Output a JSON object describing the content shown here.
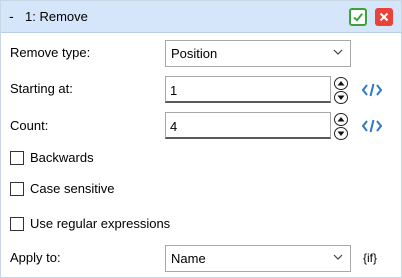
{
  "titlebar": {
    "collapse_glyph": "-",
    "title": "1: Remove",
    "accept_icon": "check-icon",
    "close_icon": "close-icon",
    "accept_color": "#3ca33a",
    "close_color": "#e8423b"
  },
  "remove_type": {
    "label": "Remove type:",
    "value": "Position"
  },
  "starting_at": {
    "label": "Starting at:",
    "value": "1"
  },
  "count": {
    "label": "Count:",
    "value": "4"
  },
  "options": {
    "backwards": {
      "label": "Backwards",
      "checked": false
    },
    "case_sensitive": {
      "label": "Case sensitive",
      "checked": false
    },
    "regex": {
      "label": "Use regular expressions",
      "checked": false
    }
  },
  "apply_to": {
    "label": "Apply to:",
    "value": "Name",
    "tag": "{if}"
  },
  "colors": {
    "titlebar_bg": "#d6e6fa",
    "code_icon": "#2b79c9"
  }
}
